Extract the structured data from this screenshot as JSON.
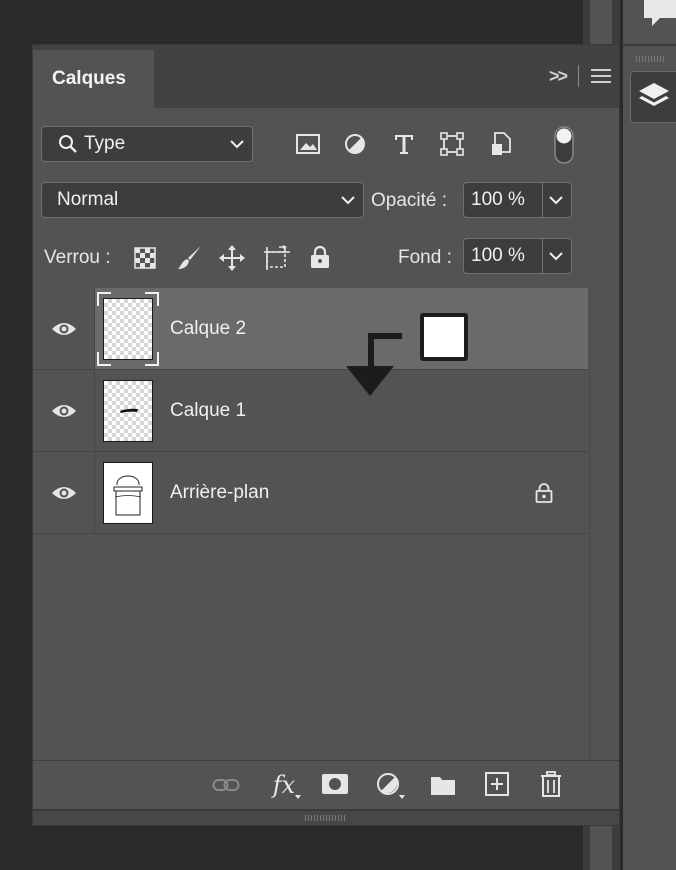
{
  "panel": {
    "tab_title": "Calques",
    "expand_label": ">>",
    "filter": {
      "value": "Type"
    },
    "blend_mode": {
      "value": "Normal"
    },
    "opacity": {
      "label": "Opacité :",
      "value": "100 %"
    },
    "lock": {
      "label": "Verrou :"
    },
    "fill": {
      "label": "Fond :",
      "value": "100 %"
    },
    "filter_icons": [
      "image-filter-icon",
      "adjustment-filter-icon",
      "type-filter-icon",
      "shape-filter-icon",
      "smart-object-filter-icon",
      "filter-toggle-icon"
    ],
    "lock_icons": [
      "lock-transparent-pixels-icon",
      "lock-image-pixels-icon",
      "lock-position-icon",
      "prevent-autonest-icon",
      "lock-all-icon"
    ],
    "layers": [
      {
        "name": "Calque 2",
        "selected": true,
        "visible": true,
        "thumbnail": "transparent"
      },
      {
        "name": "Calque 1",
        "selected": false,
        "visible": true,
        "thumbnail": "transparent-with-stroke"
      },
      {
        "name": "Arrière-plan",
        "selected": false,
        "visible": true,
        "thumbnail": "white-drawing",
        "locked": true
      }
    ],
    "bottom_icons": [
      "link-layers-icon",
      "fx-icon",
      "layer-mask-icon",
      "adjustment-layer-icon",
      "new-group-icon",
      "new-layer-icon",
      "delete-layer-icon"
    ],
    "fx_label": "fx"
  },
  "colors": {
    "panel_bg": "#535353",
    "selected_row": "#6a6a6a",
    "app_bg": "#2a2a2a"
  }
}
